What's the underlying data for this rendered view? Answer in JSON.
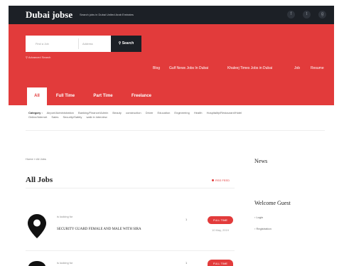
{
  "header": {
    "logo": "Dubai jobse",
    "tagline": "Search jobs in Dubai United Arab Emirates",
    "social": [
      {
        "icon": "facebook-icon",
        "glyph": "f"
      },
      {
        "icon": "twitter-icon",
        "glyph": "t"
      },
      {
        "icon": "google-plus-icon",
        "glyph": "g"
      }
    ]
  },
  "search": {
    "what_placeholder": "Find a Job",
    "where_placeholder": "Address",
    "button_label": "Search",
    "advanced_label": "Advanced Search"
  },
  "nav": {
    "links": [
      "Blog",
      "Gulf News Jobs In Dubai",
      "Khaleej Times Jobs in Dubai",
      "Job",
      "Resume"
    ]
  },
  "tabs": [
    "All",
    "Full Time",
    "Part Time",
    "Freelance"
  ],
  "categories": {
    "label": "Category :",
    "items": [
      "Airport/Administration",
      "Banking/Finance/Admin",
      "Beauty",
      "construction",
      "Driver",
      "Education",
      "Engineering",
      "Health",
      "Hospitality/Restaurant/Hotel",
      "Online/Internet",
      "Sales",
      "Security/Safety",
      "walk in interview"
    ]
  },
  "breadcrumb": "Home » All Jobs",
  "page_title": "All Jobs",
  "rss_label": "RSS FEED",
  "jobs": [
    {
      "looking": "is looking for",
      "title": "SECURITY GUARD FEMALE AND MALE WITH SIRA",
      "num": "1",
      "badge": "FULL TIME",
      "date": "10 May, 2019"
    },
    {
      "looking": "is looking for",
      "num": "1",
      "badge": "FULL TIME"
    }
  ],
  "sidebar": {
    "news_title": "News",
    "welcome_title": "Welcome Guest",
    "links": [
      "Login",
      "Registration"
    ]
  },
  "colors": {
    "brand_red": "#e23b3b",
    "dark": "#1c2026"
  }
}
